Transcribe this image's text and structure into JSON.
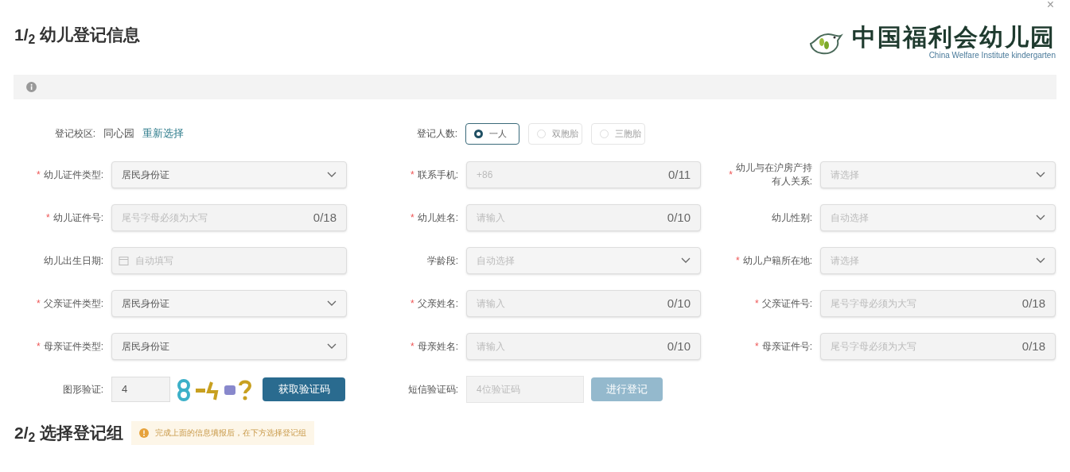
{
  "close": "×",
  "section1": {
    "title": "1/$_{2}$ 幼儿登记信息"
  },
  "logo": {
    "name": "中国福利会幼儿园",
    "subtitle": "China Welfare Institute kindergarten"
  },
  "campus": {
    "label": "登记校区:",
    "value": "同心园",
    "link": "重新选择"
  },
  "count": {
    "label": "登记人数:",
    "options": [
      {
        "label": "一人",
        "selected": true
      },
      {
        "label": "双胞胎",
        "selected": false
      },
      {
        "label": "三胞胎",
        "selected": false
      }
    ]
  },
  "rows": [
    [
      {
        "label": "幼儿证件类型:",
        "required_mark": "*",
        "kind": "select",
        "value": "居民身份证"
      },
      {
        "label": "联系手机:",
        "required_mark": "*",
        "kind": "input",
        "placeholder": "+86",
        "counter": "0/11"
      },
      {
        "label": "幼儿与在沪房产持有人关系:",
        "required_mark": "*",
        "kind": "select",
        "placeholder": "请选择"
      }
    ],
    [
      {
        "label": "幼儿证件号:",
        "required_mark": "*",
        "kind": "input",
        "placeholder": "尾号字母必须为大写",
        "counter": "0/18"
      },
      {
        "label": "幼儿姓名:",
        "required_mark": "*",
        "kind": "input",
        "placeholder": "请输入",
        "counter": "0/10"
      },
      {
        "label": "幼儿性别:",
        "kind": "select",
        "placeholder": "自动选择"
      }
    ],
    [
      {
        "label": "幼儿出生日期:",
        "kind": "date",
        "placeholder": "自动填写"
      },
      {
        "label": "学龄段:",
        "kind": "select",
        "placeholder": "自动选择"
      },
      {
        "label": "幼儿户籍所在地:",
        "required_mark": "*",
        "kind": "select",
        "placeholder": "请选择"
      }
    ],
    [
      {
        "label": "父亲证件类型:",
        "required_mark": "*",
        "kind": "select",
        "value": "居民身份证"
      },
      {
        "label": "父亲姓名:",
        "required_mark": "*",
        "kind": "input",
        "placeholder": "请输入",
        "counter": "0/10"
      },
      {
        "label": "父亲证件号:",
        "required_mark": "*",
        "kind": "input",
        "placeholder": "尾号字母必须为大写",
        "counter": "0/18"
      }
    ],
    [
      {
        "label": "母亲证件类型:",
        "required_mark": "*",
        "kind": "select",
        "value": "居民身份证"
      },
      {
        "label": "母亲姓名:",
        "required_mark": "*",
        "kind": "input",
        "placeholder": "请输入",
        "counter": "0/10"
      },
      {
        "label": "母亲证件号:",
        "required_mark": "*",
        "kind": "input",
        "placeholder": "尾号字母必须为大写",
        "counter": "0/18"
      }
    ]
  ],
  "captcha": {
    "label": "图形验证:",
    "value": "4",
    "button": "获取验证码"
  },
  "sms": {
    "label": "短信验证码:",
    "placeholder": "4位验证码",
    "button": "进行登记",
    "disabled": true
  },
  "section2": {
    "title": "2/$_{2}$ 选择登记组",
    "notice": "完成上面的信息填报后，在下方选择登记组"
  }
}
